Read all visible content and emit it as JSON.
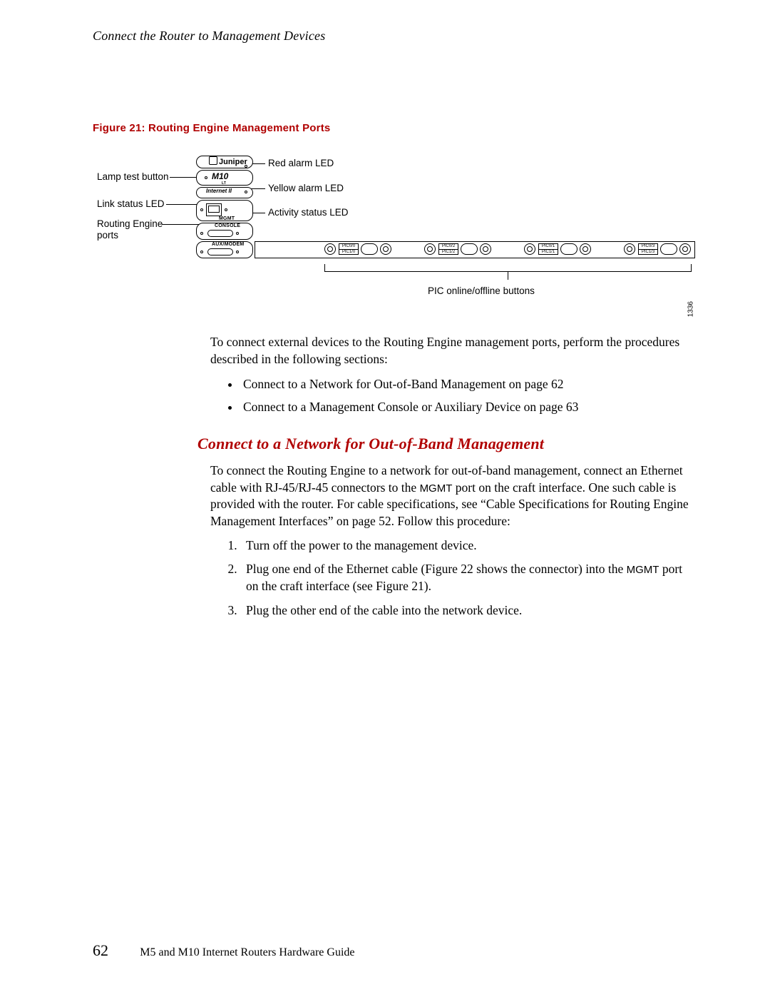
{
  "header": {
    "running_head": "Connect the Router to Management Devices"
  },
  "figure": {
    "caption": "Figure 21: Routing Engine Management Ports",
    "sidecode": "1336",
    "labels_left": {
      "lamp_test": "Lamp test button",
      "link_status": "Link status LED",
      "re_ports_l1": "Routing Engine",
      "re_ports_l2": "ports"
    },
    "labels_right": {
      "red_alarm": "Red alarm LED",
      "yellow_alarm": "Yellow alarm LED",
      "activity_status": "Activity status LED"
    },
    "labels_bottom": {
      "pic_buttons": "PIC online/offline buttons"
    },
    "brand": {
      "vendor": "Juniper",
      "model": "M10",
      "internet": "Internet II"
    },
    "portlabels": {
      "mgmt": "MGMT",
      "console": "CONSOLE",
      "aux": "AUX/MODEM",
      "lt": "LT"
    },
    "pics": [
      {
        "top": "PIC0/0",
        "bottom": "PIC1/0"
      },
      {
        "top": "PIC0/2",
        "bottom": "PIC1/2"
      },
      {
        "top": "PIC0/1",
        "bottom": "PIC1/1"
      },
      {
        "top": "PIC0/3",
        "bottom": "PIC1/3"
      }
    ]
  },
  "intro": {
    "p1": "To connect external devices to the Routing Engine management ports, perform the procedures described in the following sections:",
    "bullets": [
      "Connect to a Network for Out-of-Band Management on page 62",
      "Connect to a Management Console or Auxiliary Device on page 63"
    ]
  },
  "section": {
    "title": "Connect to a Network for Out-of-Band Management",
    "p1a": "To connect the Routing Engine to a network for out-of-band management, connect an Ethernet cable with RJ-45/RJ-45 connectors to the ",
    "mgmt_word": "MGMT",
    "p1b": " port on the craft interface. One such cable is provided with the router. For cable specifications, see “Cable Specifications for Routing Engine Management Interfaces” on page 52. Follow this procedure:",
    "steps": [
      {
        "text_a": "Turn off the power to the management device.",
        "text_b": ""
      },
      {
        "text_a": "Plug one end of the Ethernet cable (Figure 22 shows the connector) into the ",
        "mgmt": "MGMT",
        "text_b": " port on the craft interface (see Figure 21)."
      },
      {
        "text_a": "Plug the other end of the cable into the network device.",
        "text_b": ""
      }
    ]
  },
  "footer": {
    "page": "62",
    "guide": "M5 and M10 Internet Routers Hardware Guide"
  }
}
